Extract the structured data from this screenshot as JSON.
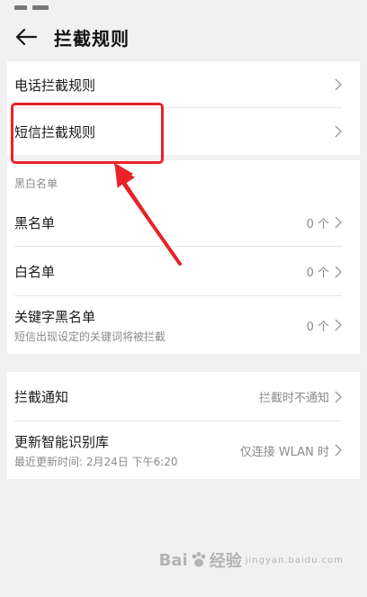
{
  "appbar": {
    "title": "拦截规则",
    "back_icon": "arrow-left-icon"
  },
  "section1": {
    "items": [
      {
        "label": "电话拦截规则"
      },
      {
        "label": "短信拦截规则"
      }
    ]
  },
  "section2": {
    "header": "黑白名单",
    "items": [
      {
        "label": "黑名单",
        "value": "0 个"
      },
      {
        "label": "白名单",
        "value": "0 个"
      },
      {
        "label": "关键字黑名单",
        "sub": "短信出现设定的关键词将被拦截",
        "value": "0 个"
      }
    ]
  },
  "section3": {
    "items": [
      {
        "label": "拦截通知",
        "value": "拦截时不通知"
      },
      {
        "label": "更新智能识别库",
        "sub": "最近更新时间: 2月24日 下午6:20",
        "value": "仅连接 WLAN 时"
      }
    ]
  },
  "annotation": {
    "color": "#e8232a"
  },
  "watermark": {
    "brand_left": "Bai",
    "brand_right": "经验",
    "sub": "jingyan.baidu.com"
  }
}
